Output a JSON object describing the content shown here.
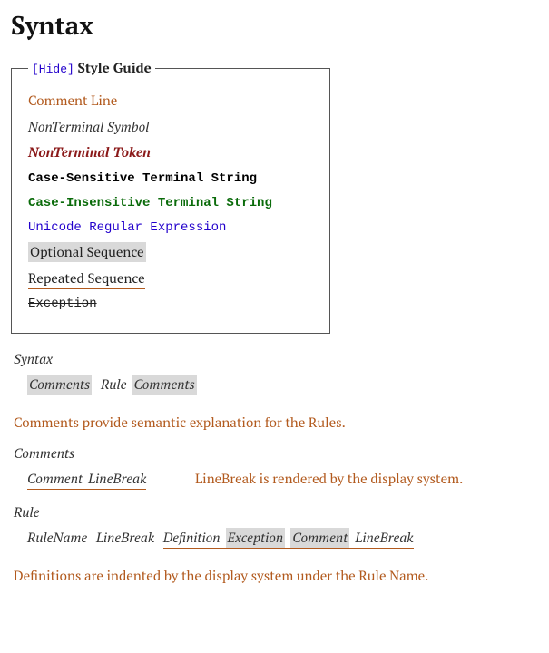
{
  "heading": "Syntax",
  "legend": {
    "hide": "[Hide]",
    "title": "Style Guide",
    "comment_line": "Comment Line",
    "nonterminal_symbol": "NonTerminal Symbol",
    "nonterminal_token": "NonTerminal Token",
    "case_sensitive": "Case-Sensitive Terminal String",
    "case_insensitive": "Case-Insensitive Terminal String",
    "unicode_re": "Unicode Regular Expression",
    "optional_seq": "Optional Sequence",
    "repeated_seq": "Repeated Sequence",
    "exception": "Exception"
  },
  "rules": {
    "syntax": {
      "name": "Syntax",
      "parts": {
        "comments1": "Comments",
        "rule": "Rule",
        "comments2": "Comments"
      }
    },
    "comments_explain": "Comments provide semantic explanation for the Rules.",
    "comments": {
      "name": "Comments",
      "parts": {
        "comment": "Comment",
        "linebreak": "LineBreak"
      },
      "note": "LineBreak is rendered by the display system."
    },
    "rule": {
      "name": "Rule",
      "parts": {
        "rulename": "RuleName",
        "linebreak1": "LineBreak",
        "definition": "Definition",
        "exception": "Exception",
        "comment": "Comment",
        "linebreak2": "LineBreak"
      }
    },
    "definitions_explain": "Definitions are indented by the display system under the Rule Name."
  }
}
